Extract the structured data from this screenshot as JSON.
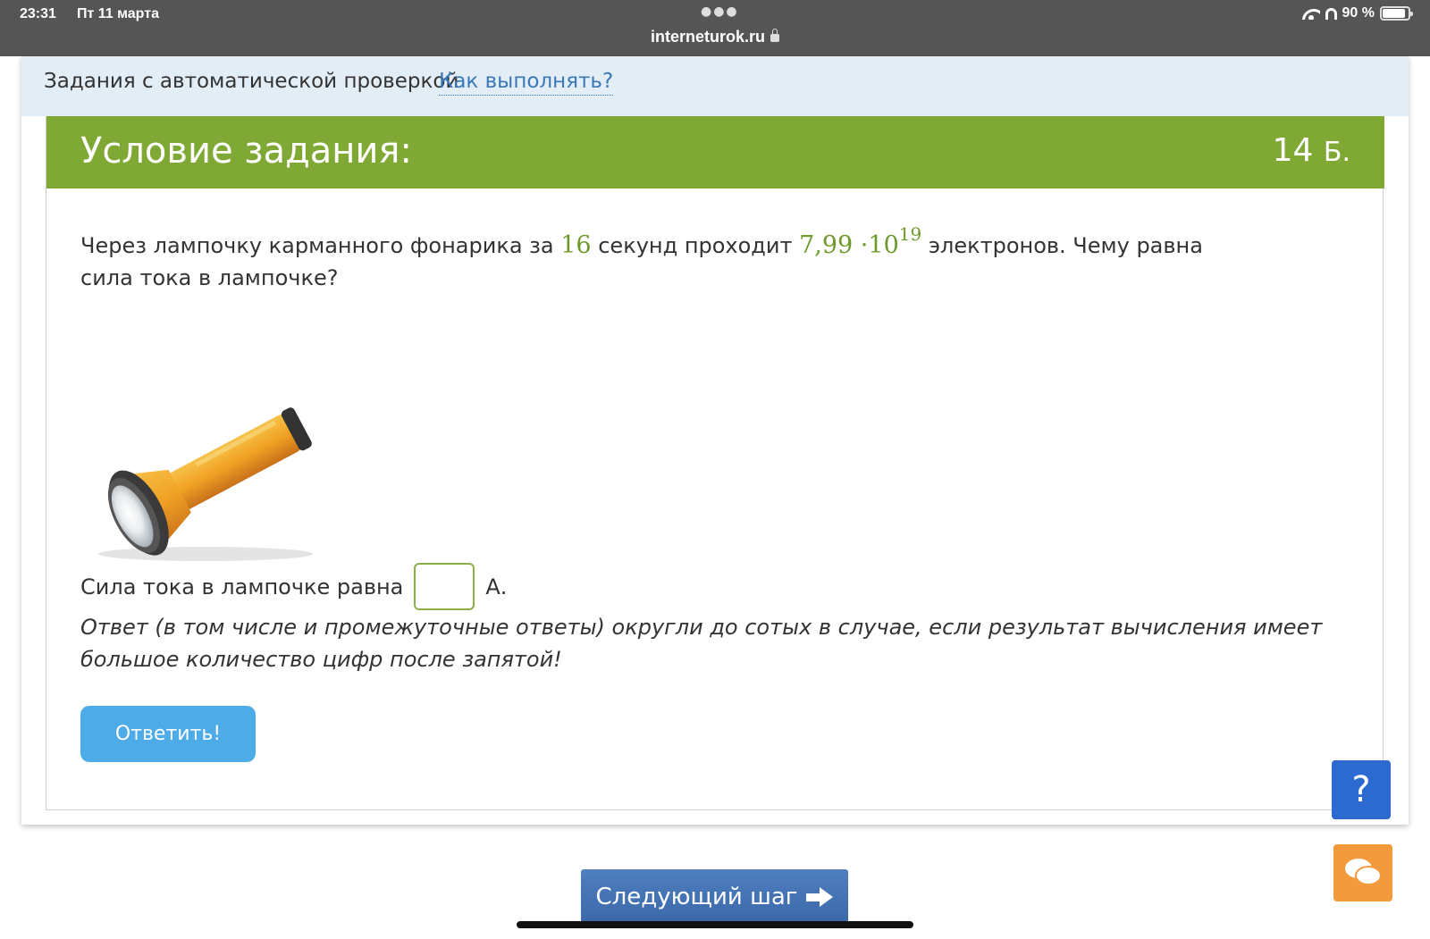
{
  "status_bar": {
    "time": "23:31",
    "date": "Пт 11 марта",
    "url": "interneturok.ru",
    "battery": "90 %",
    "battery_level": 0.9
  },
  "top_strip": {
    "title": "Задания с автоматической проверкой",
    "link": "Как выполнять?"
  },
  "task": {
    "header_title": "Условие задания:",
    "points_value": "14",
    "points_unit": "Б.",
    "problem": {
      "part1": "Через лампочку карманного фонарика за ",
      "time_value": "16",
      "part2": " секунд проходит ",
      "electrons_mantissa": "7,99 ·10",
      "electrons_exponent": "19",
      "part3": " электронов. Чему равна сила тока в лампочке?"
    },
    "answer_label": "Сила тока в лампочке равна",
    "answer_value": "",
    "answer_unit": "А.",
    "note": "Ответ (в том числе и промежуточные ответы) округли до сотых в случае, если результат вычисления имеет большое количество цифр после запятой!",
    "submit_label": "Ответить!"
  },
  "help_label": "?",
  "next_step_label": "Следующий шаг",
  "colors": {
    "header_green": "#80a834",
    "math_green": "#6d9a2a",
    "answer_blue": "#4dabe8",
    "help_blue": "#2c6ad1",
    "chat_orange": "#f39a3d",
    "next_blue": "#3a67a8"
  }
}
